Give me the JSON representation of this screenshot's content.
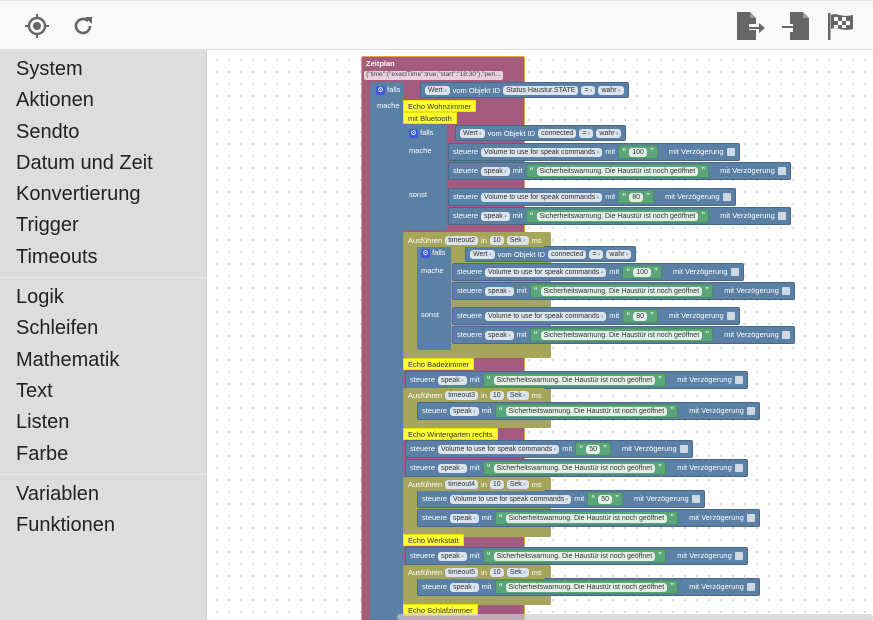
{
  "toolbar": {
    "left_icons": [
      {
        "name": "target-icon",
        "title": "Locate"
      },
      {
        "name": "refresh-icon",
        "title": "Refresh"
      }
    ],
    "right_icons": [
      {
        "name": "export-icon"
      },
      {
        "name": "import-icon"
      },
      {
        "name": "checkered-flag-icon"
      }
    ]
  },
  "sidebar": {
    "groups": [
      [
        "System",
        "Aktionen",
        "Sendto",
        "Datum und Zeit",
        "Konvertierung",
        "Trigger",
        "Timeouts"
      ],
      [
        "Logik",
        "Schleifen",
        "Mathematik",
        "Text",
        "Listen",
        "Farbe"
      ],
      [
        "Variablen",
        "Funktionen"
      ]
    ]
  },
  "workspace": {
    "schedule": {
      "title": "Zeitplan",
      "param": "{\"time\":{\"exactTime\":true,\"start\":\"18:30\"},\"peri..."
    },
    "labels": {
      "if": "falls",
      "do": "mache",
      "else": "sonst",
      "value": "Wert",
      "of_object": "vom Objekt ID",
      "eq": "=",
      "true": "wahr",
      "control": "steuere",
      "with": "mit",
      "delay": "mit Verzögerung",
      "execute": "Ausführen",
      "in": "in",
      "unit": "Sek",
      "ms": "ms"
    },
    "objects": {
      "status": "Status Haustur.STATE",
      "connected": "connected",
      "volume": "Volume to use for speak commands",
      "speak": "speak"
    },
    "message": "Sicherheitswarnung. Die Haustür ist noch geöffnet",
    "vol100": "100",
    "vol80": "80",
    "vol50": "50",
    "timeout_value": "10",
    "comments": {
      "wohnzimmer": "Echo Wohnzimmer",
      "bluetooth": "mit Bluetooth",
      "badezimmer": "Echo Badezimmer",
      "wintergarten": "Echo Wintergarten rechts",
      "werkstatt": "Echo Werkstatt",
      "schlafzimmer": "Echo Schlafzimmer"
    },
    "timeouts": [
      "timeout2",
      "timeout3",
      "timeout4",
      "timeout5"
    ]
  }
}
